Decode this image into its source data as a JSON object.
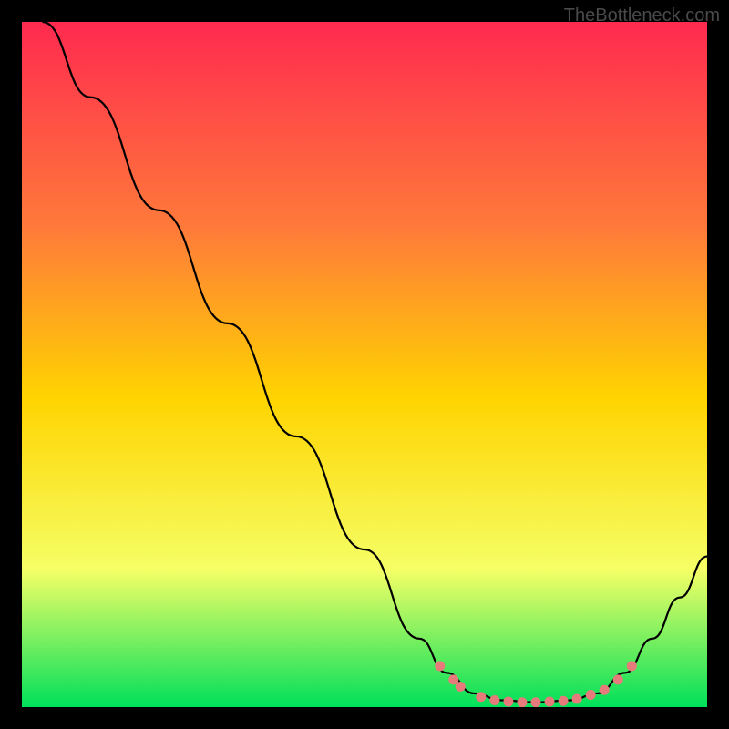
{
  "watermark": "TheBottleneck.com",
  "chart_data": {
    "type": "line",
    "title": "",
    "xlabel": "",
    "ylabel": "",
    "xlim": [
      0,
      100
    ],
    "ylim": [
      0,
      100
    ],
    "gradient_colors": {
      "top": "#ff2a4f",
      "mid_upper": "#ff7a3a",
      "mid": "#ffd400",
      "mid_lower": "#f5ff66",
      "bottom": "#00e05a"
    },
    "series": [
      {
        "name": "curve",
        "points": [
          {
            "x": 3,
            "y": 100
          },
          {
            "x": 10,
            "y": 89
          },
          {
            "x": 20,
            "y": 72.5
          },
          {
            "x": 30,
            "y": 56
          },
          {
            "x": 40,
            "y": 39.5
          },
          {
            "x": 50,
            "y": 23
          },
          {
            "x": 58,
            "y": 10
          },
          {
            "x": 62,
            "y": 5
          },
          {
            "x": 66,
            "y": 2
          },
          {
            "x": 70,
            "y": 1
          },
          {
            "x": 75,
            "y": 0.7
          },
          {
            "x": 80,
            "y": 1
          },
          {
            "x": 84,
            "y": 2
          },
          {
            "x": 88,
            "y": 5
          },
          {
            "x": 92,
            "y": 10
          },
          {
            "x": 96,
            "y": 16
          },
          {
            "x": 100,
            "y": 22
          }
        ]
      }
    ],
    "markers": [
      {
        "x": 61,
        "y": 6
      },
      {
        "x": 63,
        "y": 4
      },
      {
        "x": 64,
        "y": 3
      },
      {
        "x": 67,
        "y": 1.5
      },
      {
        "x": 69,
        "y": 1
      },
      {
        "x": 71,
        "y": 0.8
      },
      {
        "x": 73,
        "y": 0.7
      },
      {
        "x": 75,
        "y": 0.7
      },
      {
        "x": 77,
        "y": 0.8
      },
      {
        "x": 79,
        "y": 0.9
      },
      {
        "x": 81,
        "y": 1.2
      },
      {
        "x": 83,
        "y": 1.8
      },
      {
        "x": 85,
        "y": 2.5
      },
      {
        "x": 87,
        "y": 4
      },
      {
        "x": 89,
        "y": 6
      }
    ],
    "marker_color": "#e77a7a",
    "line_color": "#000000"
  }
}
